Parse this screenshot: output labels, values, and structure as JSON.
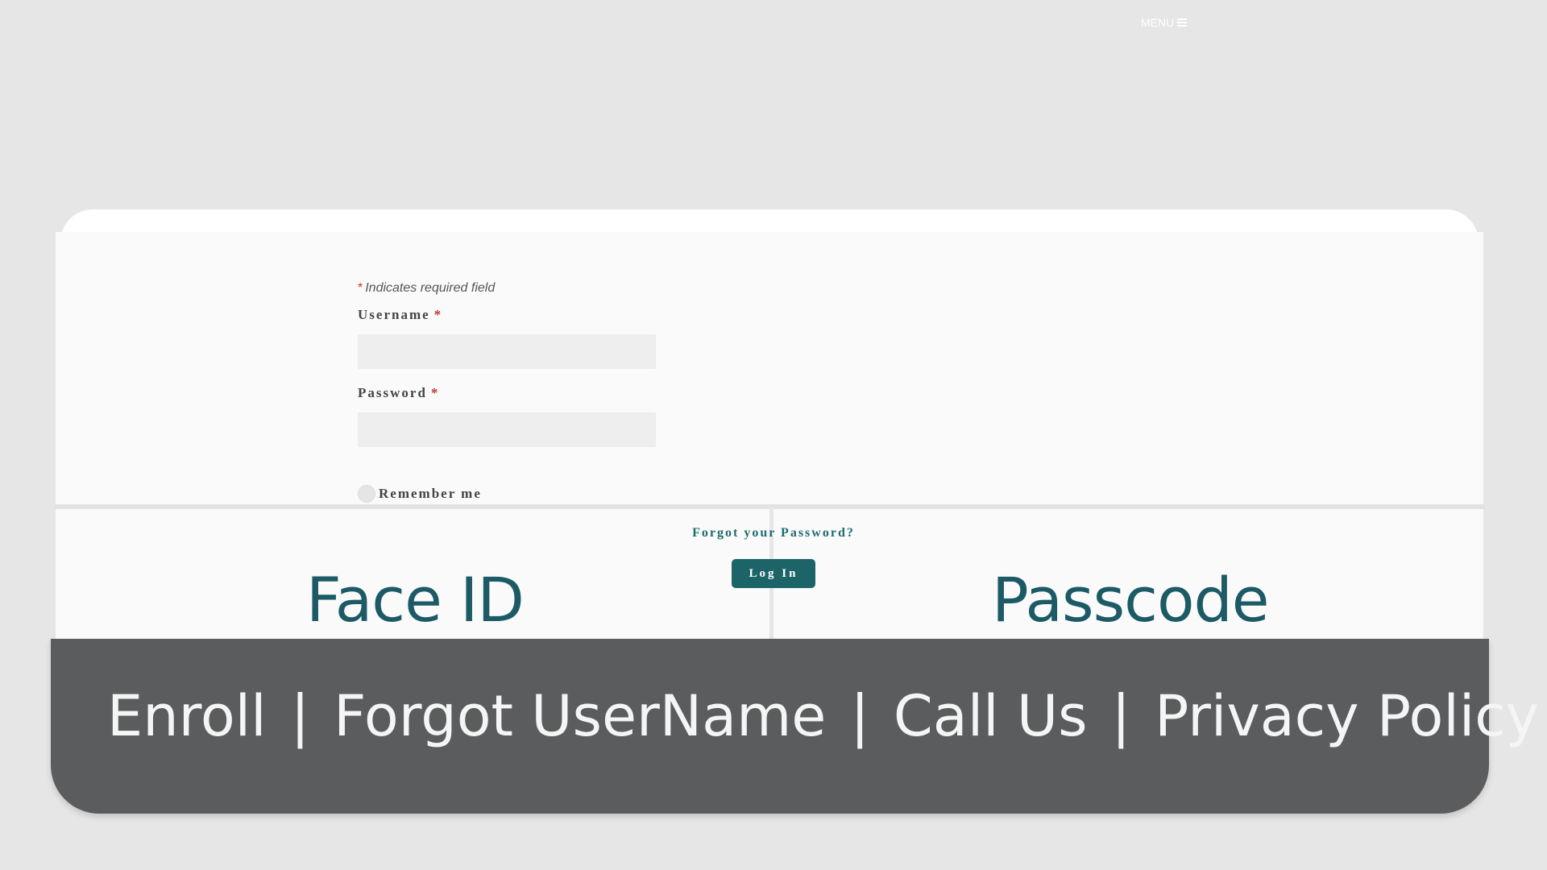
{
  "header": {
    "menu_label": "MENU"
  },
  "background": {
    "faceid_text": "Face ID",
    "passcode_text": "Passcode",
    "links": [
      "Enroll",
      "Forgot UserName",
      "Call Us",
      "Privacy Policy"
    ],
    "separator": "|"
  },
  "form": {
    "required_star": "*",
    "required_note": "Indicates required field",
    "username_label": "Username",
    "password_label": "Password",
    "username_value": "",
    "password_value": "",
    "remember_label": "Remember me",
    "forgot_link": "Forgot your Password?",
    "login_button": "Log In"
  },
  "colors": {
    "background": "#e6e6e6",
    "accent": "#1c6468",
    "required": "#c0392b",
    "footer_dark": "#5a5c5e"
  }
}
